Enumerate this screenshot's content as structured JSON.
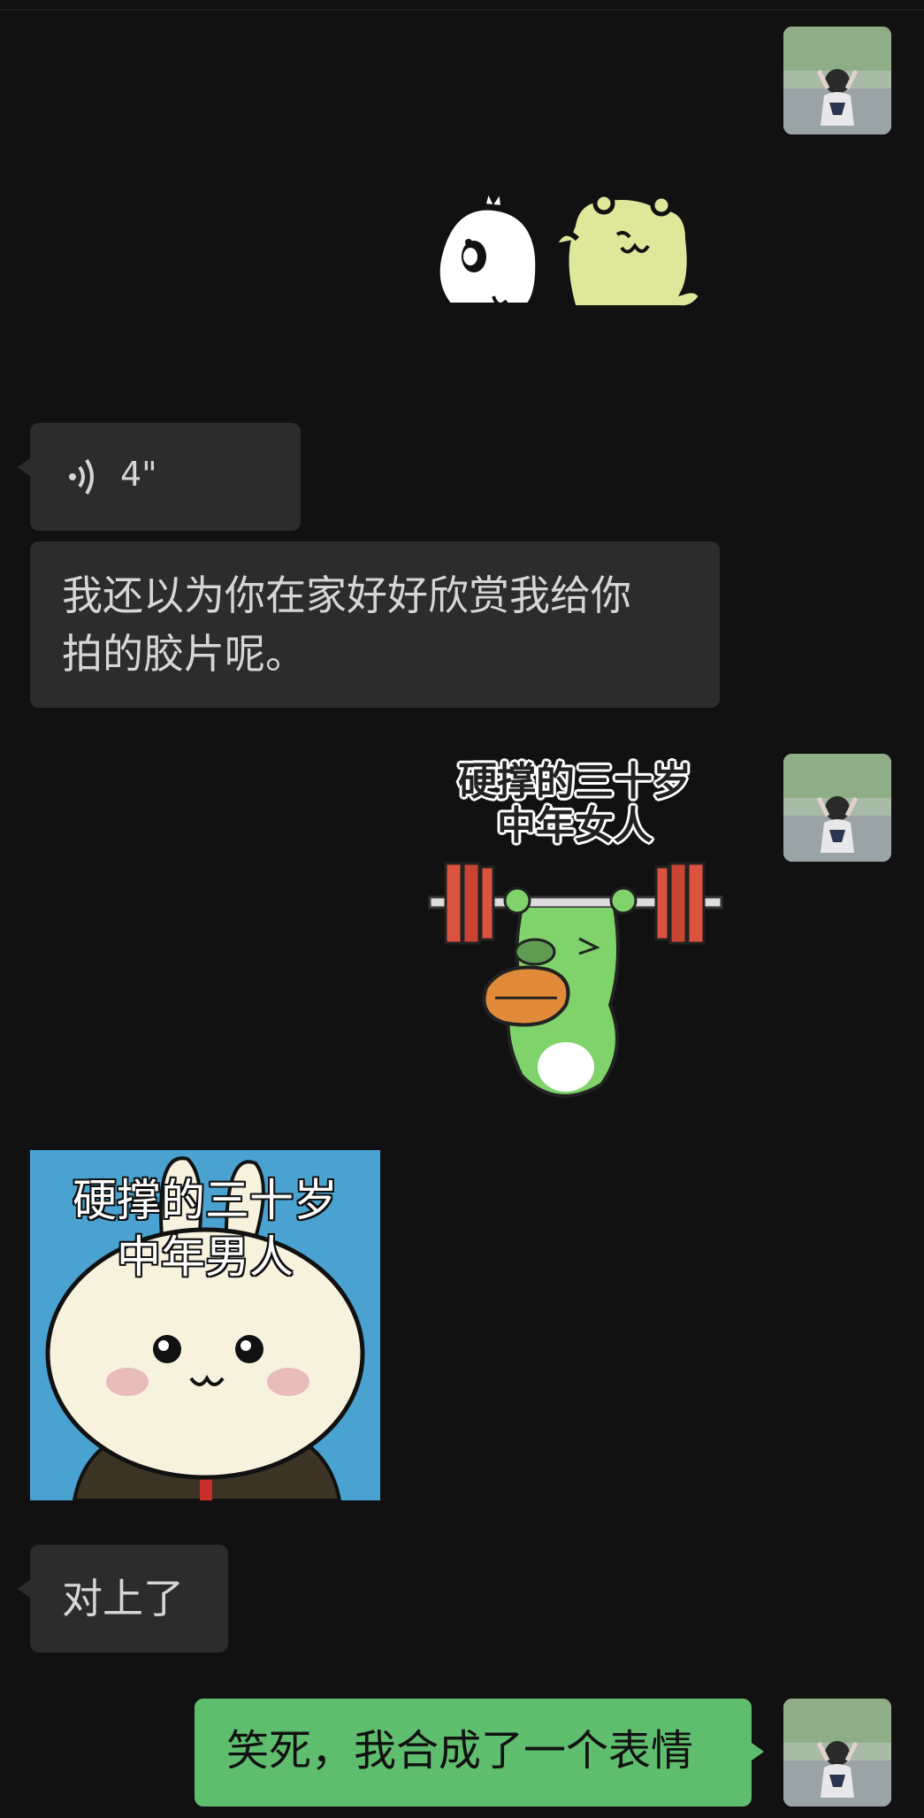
{
  "messages": {
    "voice_duration": "4\"",
    "text_received_1": "我还以为你在家好好欣赏我给你",
    "text_received_1_line2": "拍的胶片呢。",
    "text_received_2": "对上了",
    "text_sent_1": "笑死，我合成了一个表情"
  },
  "stickers": {
    "frog_caption_line1": "硬撑的三十岁",
    "frog_caption_line2": "中年女人",
    "bunny_caption_line1": "硬撑的三十岁",
    "bunny_caption_line2": "中年男人"
  },
  "colors": {
    "background": "#111111",
    "received_bubble": "#2c2c2c",
    "sent_bubble": "#5fbe6e"
  }
}
